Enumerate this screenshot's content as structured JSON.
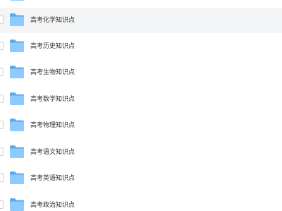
{
  "file_list": {
    "items": [
      {
        "name": "",
        "highlighted": false
      },
      {
        "name": "高考化学知识点",
        "highlighted": true
      },
      {
        "name": "高考历史知识点",
        "highlighted": false
      },
      {
        "name": "高考生物知识点",
        "highlighted": false
      },
      {
        "name": "高考数学知识点",
        "highlighted": false
      },
      {
        "name": "高考物理知识点",
        "highlighted": false
      },
      {
        "name": "高考语文知识点",
        "highlighted": false
      },
      {
        "name": "高考英语知识点",
        "highlighted": false
      },
      {
        "name": "高考政治知识点",
        "highlighted": false
      }
    ],
    "icon": "folder-icon",
    "colors": {
      "folder_back": "#5aa9f0",
      "folder_front": "#8fcaff",
      "row_highlight": "#f4f5f6",
      "text": "#333333"
    }
  }
}
